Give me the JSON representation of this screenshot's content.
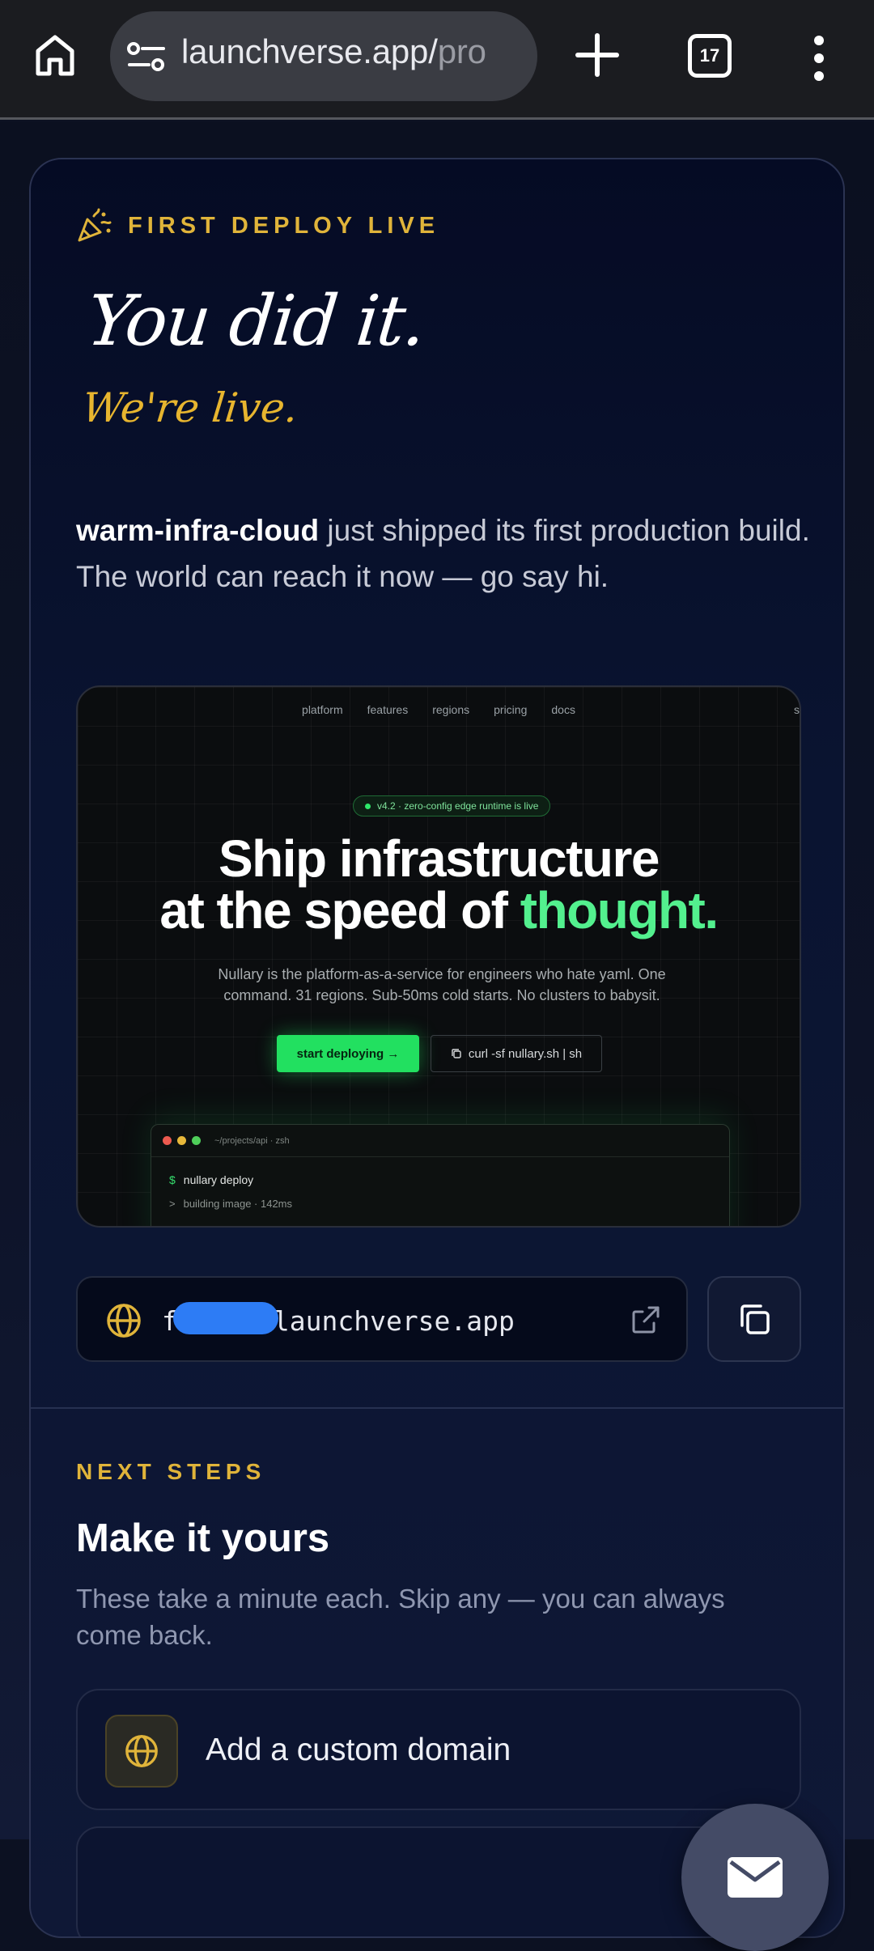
{
  "browser": {
    "url_main": "launchverse.app/",
    "url_dim": "pro",
    "tab_count": "17"
  },
  "hero": {
    "eyebrow": "FIRST DEPLOY LIVE",
    "title": "You did it.",
    "subtitle": "We're live.",
    "project_name": "warm-infra-cloud",
    "intro_rest": " just shipped its first production build. The world can reach it now — go say hi."
  },
  "preview": {
    "nav": [
      "platform",
      "features",
      "regions",
      "pricing",
      "docs"
    ],
    "nav_right": "s",
    "badge": "v4.2 · zero-config edge runtime is live",
    "headline_line1": "Ship infrastructure",
    "headline_line2_start": "at the speed of ",
    "headline_accent": "thought.",
    "copy": "Nullary is the platform-as-a-service for engineers who hate yaml. One command. 31 regions. Sub-50ms cold starts. No clusters to babysit.",
    "cta_primary": "start deploying →",
    "cta_secondary": "curl -sf nullary.sh | sh",
    "terminal_title": "~/projects/api · zsh",
    "terminal_prompt": "$",
    "terminal_cmd": "nullary deploy",
    "terminal_out_prefix": ">",
    "terminal_out": "building image · 142ms"
  },
  "deploy_url": {
    "prefix": "f",
    "suffix": "launchverse.app"
  },
  "next_steps": {
    "label": "NEXT STEPS",
    "title": "Make it yours",
    "description": "These take a minute each. Skip any — you can always come back.",
    "items": [
      {
        "label": "Add a custom domain",
        "icon": "globe-icon"
      }
    ]
  },
  "colors": {
    "accent_gold": "#e0b43a",
    "accent_green": "#53f08e",
    "redaction_blue": "#2d7cf5"
  }
}
